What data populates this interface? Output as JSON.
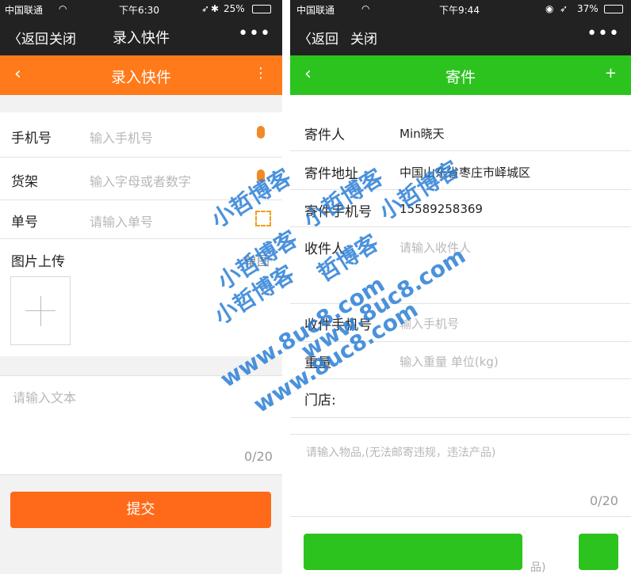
{
  "left": {
    "status": {
      "carrier": "中国联通",
      "time": "下午6:30",
      "battery": "25%"
    },
    "wechat_bar": {
      "back": "返回",
      "close": "关闭",
      "title": "录入快件",
      "more": "•••"
    },
    "app_bar": {
      "title": "录入快件",
      "color": "#ff7a1a"
    },
    "form": {
      "phone": {
        "label": "手机号",
        "placeholder": "输入手机号"
      },
      "shelf": {
        "label": "货架",
        "placeholder": "输入字母或者数字"
      },
      "number": {
        "label": "单号",
        "placeholder": "请输入单号"
      },
      "image": {
        "label": "图片上传",
        "hint": "单图"
      },
      "text": {
        "placeholder": "请输入文本",
        "counter": "0/20"
      }
    },
    "submit": "提交"
  },
  "right": {
    "status": {
      "carrier": "中国联通",
      "time": "下午9:44",
      "battery": "37%"
    },
    "wechat_bar": {
      "back": "返回",
      "close": "关闭",
      "more": "•••"
    },
    "app_bar": {
      "title": "寄件",
      "color": "#2dc31f"
    },
    "form": {
      "sender": {
        "label": "寄件人",
        "value": "Min晓天"
      },
      "address": {
        "label": "寄件地址",
        "value": "中国山东省枣庄市峄城区"
      },
      "sender_phone": {
        "label": "寄件手机号",
        "value": "15589258369"
      },
      "receiver": {
        "label": "收件人",
        "placeholder": "请输入收件人"
      },
      "receiver_phone": {
        "label": "收件手机号",
        "placeholder": "输入手机号"
      },
      "weight": {
        "label": "重量",
        "placeholder": "输入重量 单位(kg)"
      },
      "store": {
        "label": "门店:"
      },
      "items": {
        "placeholder": "请输入物品,(无法邮寄违规，违法产品)",
        "counter": "0/20"
      }
    },
    "footer_fragment": "品)"
  },
  "watermark": [
    "小哲博客",
    "小哲博客",
    "小哲博客",
    "小哲博客",
    "哲博客",
    "小哲博客",
    "www.8uc8.com",
    "www.8uc8.com",
    "www.8uc8.com"
  ]
}
